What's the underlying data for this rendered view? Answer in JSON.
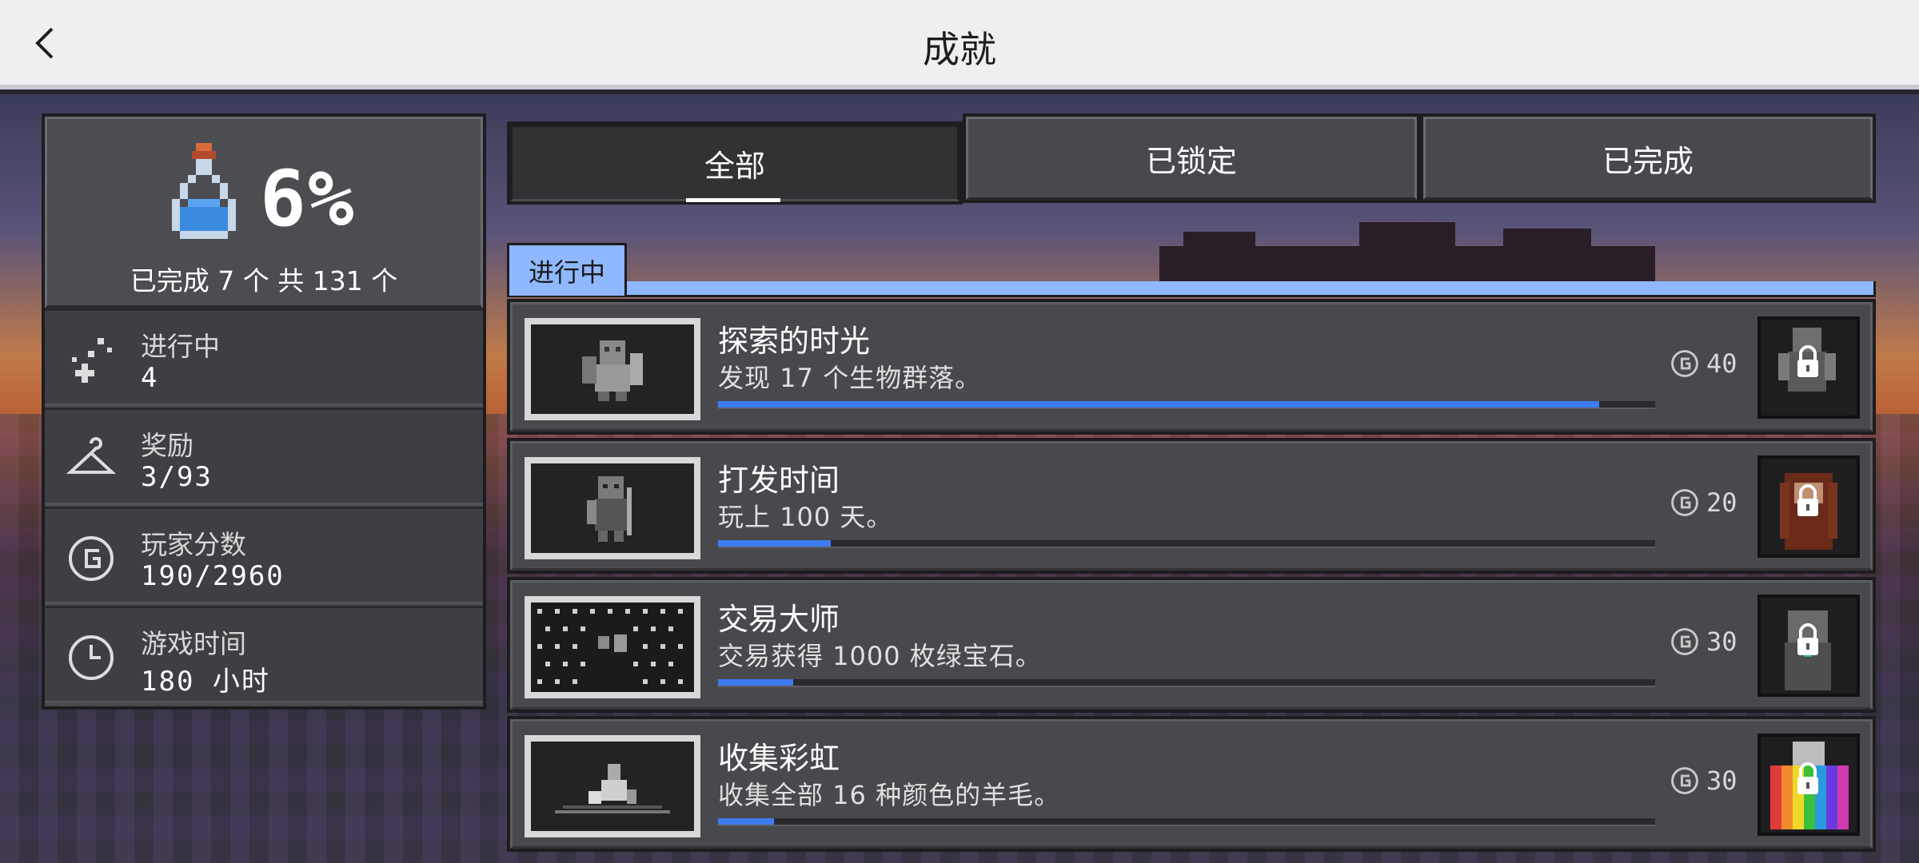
{
  "header": {
    "title": "成就"
  },
  "summary": {
    "percent": "6%",
    "text": "已完成 7 个 共 131 个",
    "progress": 0.06
  },
  "stats": [
    {
      "icon": "sparkle-icon",
      "label": "进行中",
      "value": "4"
    },
    {
      "icon": "hanger-icon",
      "label": "奖励",
      "value": "3/93"
    },
    {
      "icon": "gamerscore-icon",
      "label": "玩家分数",
      "value": "190/2960"
    },
    {
      "icon": "clock-icon",
      "label": "游戏时间",
      "value": "180 小时"
    }
  ],
  "tabs": [
    {
      "label": "全部",
      "selected": true
    },
    {
      "label": "已锁定",
      "selected": false
    },
    {
      "label": "已完成",
      "selected": false
    }
  ],
  "section": {
    "label": "进行中"
  },
  "achievements": [
    {
      "title": "探索的时光",
      "description": "发现 17 个生物群落。",
      "score": "40",
      "progress": 0.94,
      "reward_icon": "locked-skin-icon"
    },
    {
      "title": "打发时间",
      "description": "玩上 100 天。",
      "score": "20",
      "progress": 0.12,
      "reward_icon": "locked-hair-icon"
    },
    {
      "title": "交易大师",
      "description": "交易获得 1000 枚绿宝石。",
      "score": "30",
      "progress": 0.08,
      "reward_icon": "locked-villager-icon"
    },
    {
      "title": "收集彩虹",
      "description": "收集全部 16 种颜色的羊毛。",
      "score": "30",
      "progress": 0.06,
      "reward_icon": "locked-rainbow-cape-icon"
    }
  ],
  "colors": {
    "accent": "#3d7cf0",
    "section_tag": "#8fb8ff",
    "panel": "#48494d"
  }
}
